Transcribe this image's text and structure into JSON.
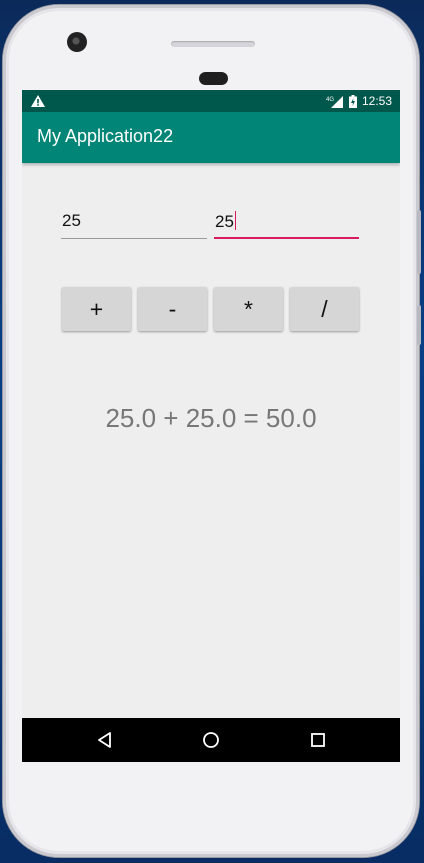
{
  "status_bar": {
    "time": "12:53",
    "network": "4G",
    "icons": [
      "warning-icon",
      "signal-icon",
      "battery-icon"
    ]
  },
  "app_bar": {
    "title": "My Application22"
  },
  "inputs": {
    "first_value": "25",
    "second_value": "25"
  },
  "operations": [
    {
      "label": "+"
    },
    {
      "label": "-"
    },
    {
      "label": "*"
    },
    {
      "label": "/"
    }
  ],
  "result": {
    "text": "25.0 + 25.0 = 50.0"
  },
  "nav_bar": {
    "icons": [
      "back-icon",
      "home-icon",
      "recents-icon"
    ]
  },
  "colors": {
    "status_bar": "#00574b",
    "app_bar": "#008577",
    "accent": "#d81b60"
  }
}
